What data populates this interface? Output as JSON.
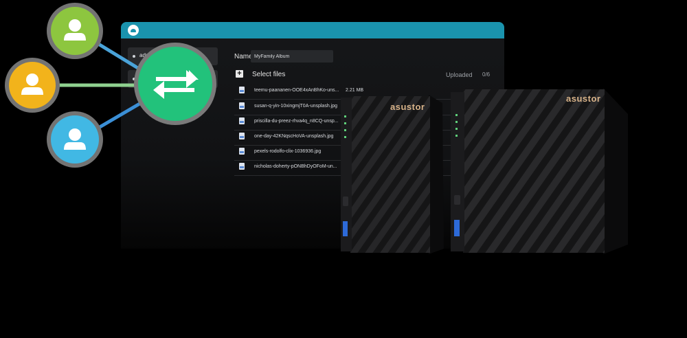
{
  "window": {
    "sidebar": {
      "items": [
        {
          "label": "admin"
        }
      ]
    },
    "name_field": {
      "label": "Name",
      "value": "MyFamily Album"
    },
    "upload": {
      "select_label": "Select files",
      "status_label": "Uploaded",
      "count": "0/6"
    },
    "files": [
      {
        "name": "teemu-paananen-OOE4xAnBhKo-uns...",
        "size": "2.21 MB"
      },
      {
        "name": "susan-q-yin-10xingmjT0A-unsplash.jpg",
        "size": ""
      },
      {
        "name": "priscilla-du-preez-rhva4q_n8CQ-unsp...",
        "size": ""
      },
      {
        "name": "one-day-42KNqscHoVA-unsplash.jpg",
        "size": ""
      },
      {
        "name": "pexels-rodolfo-clix-1036936.jpg",
        "size": ""
      },
      {
        "name": "nicholas-doherty-pONBhDyOFoM-un...",
        "size": ""
      }
    ]
  },
  "users": [
    {
      "name": "user-green",
      "color": "#8dc63f"
    },
    {
      "name": "user-yellow",
      "color": "#f2b31b"
    },
    {
      "name": "user-blue",
      "color": "#41b8e4"
    }
  ],
  "transfer_color": "#22c27b",
  "accent": "#1a93ad",
  "devices": [
    {
      "brand": "asustor"
    },
    {
      "brand": "asustor"
    }
  ]
}
